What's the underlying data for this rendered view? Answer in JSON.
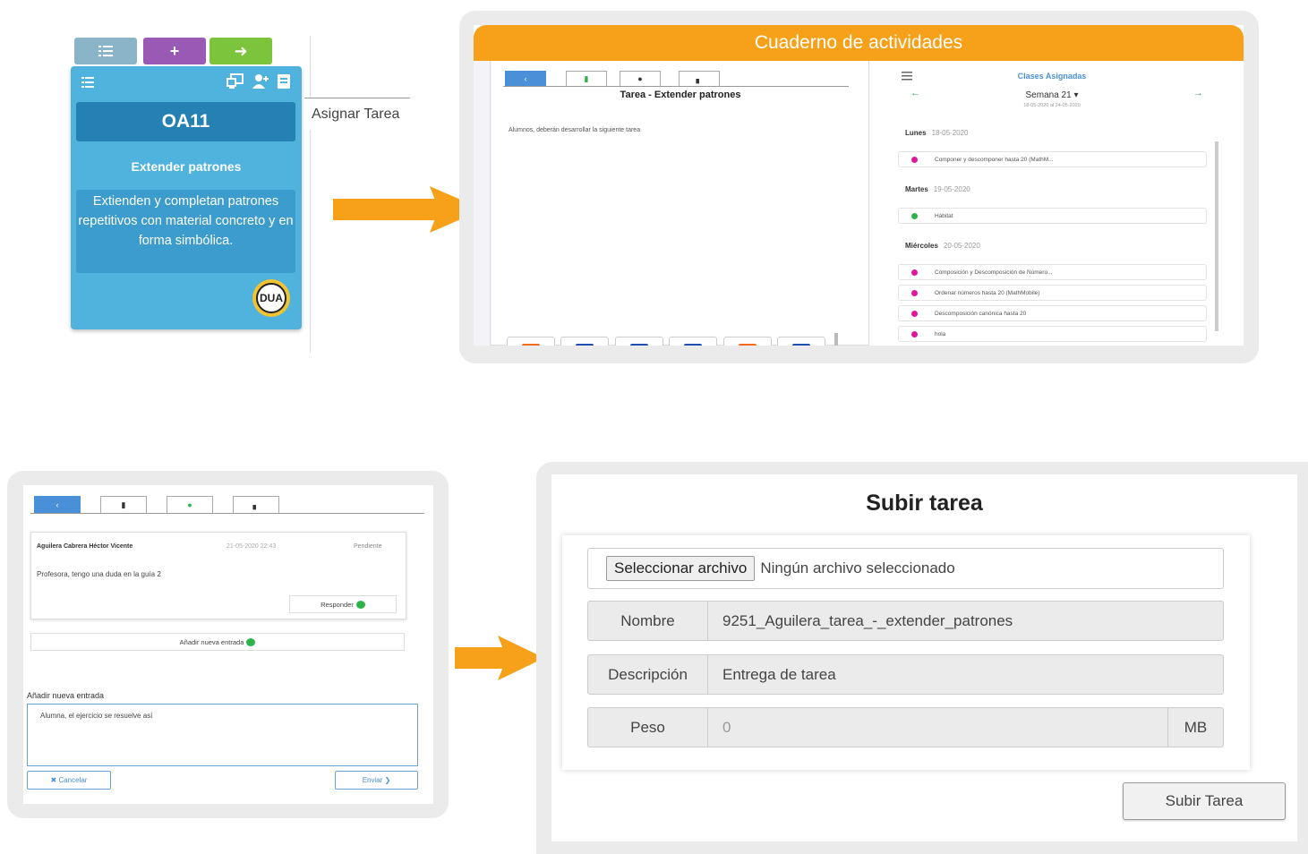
{
  "card": {
    "title": "OA11",
    "subtitle": "Extender patrones",
    "description": "Extienden y completan patrones repetitivos con material concreto y en forma simbólica.",
    "badge": "DUA",
    "tooltip": "Asignar Tarea",
    "colors": {
      "card": "#4fb3dd",
      "title_bg": "#2581b3",
      "btn_list": "#8ab4c8",
      "btn_add": "#9b59b6",
      "btn_go": "#7cc43c"
    }
  },
  "cuaderno": {
    "header": "Cuaderno de actividades",
    "task_title": "Tarea - Extender patrones",
    "task_text": "Alumnos, deberán desarrollar la siguiente tarea",
    "files": [
      {
        "type": "P",
        "icon": "powerpoint-icon"
      },
      {
        "type": "W",
        "icon": "word-icon"
      },
      {
        "type": "W",
        "icon": "word-icon"
      },
      {
        "type": "W",
        "icon": "word-icon"
      },
      {
        "type": "P",
        "icon": "powerpoint-icon"
      },
      {
        "type": "W",
        "icon": "word-icon"
      }
    ],
    "classes_title": "Clases Asignadas",
    "week": "Semana 21 ▾",
    "week_range": "18-05-2020 al 24-05-2020",
    "days": [
      {
        "name": "Lunes",
        "date": "18-05-2020",
        "items": [
          {
            "text": "Componer y descomponer hasta 20 (MathM...",
            "color": "#e0179b"
          }
        ]
      },
      {
        "name": "Martes",
        "date": "19-05-2020",
        "items": [
          {
            "text": "Hábitat",
            "color": "#2db34a"
          }
        ]
      },
      {
        "name": "Miércoles",
        "date": "20-05-2020",
        "items": [
          {
            "text": "Composición y Descomposición de Número...",
            "color": "#e0179b"
          },
          {
            "text": "Ordenar números hasta 20 (MathMobile)",
            "color": "#e0179b"
          },
          {
            "text": "Descomposición canónica hasta 20",
            "color": "#e0179b"
          },
          {
            "text": "hola",
            "color": "#e0179b"
          }
        ]
      }
    ]
  },
  "forum": {
    "author": "Aguilera Cabrera Héctor Vicente",
    "timestamp": "21-05-2020 22:43",
    "status": "Pendiente",
    "message": "Profesora, tengo una duda en la guía 2",
    "reply_label": "Responder",
    "add_entry_label": "Añadir nueva entrada",
    "new_entry_heading": "Añadir nueva entrada",
    "textarea_value": "Alumna, el ejercicio se resuelve así",
    "cancel_label": "✖ Cancelar",
    "send_label": "Enviar ❯"
  },
  "upload": {
    "title": "Subir tarea",
    "file_button": "Seleccionar archivo",
    "file_status": "Ningún archivo seleccionado",
    "name_label": "Nombre",
    "name_value": "9251_Aguilera_tarea_-_extender_patrones",
    "desc_label": "Descripción",
    "desc_value": "Entrega de tarea",
    "weight_label": "Peso",
    "weight_value": "0",
    "weight_unit": "MB",
    "submit_label": "Subir Tarea"
  },
  "colors": {
    "orange": "#f7a11a",
    "blue": "#4a90d9"
  }
}
